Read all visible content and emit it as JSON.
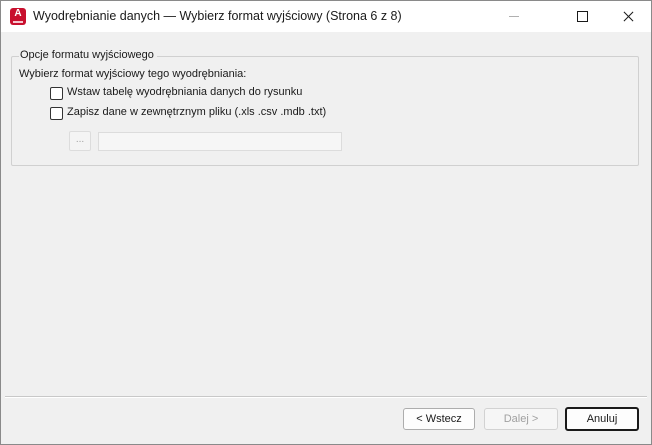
{
  "window": {
    "title": "Wyodrębnianie danych — Wybierz format wyjściowy (Strona 6 z 8)",
    "app_icon_letter": "A",
    "controls": [
      "minimize-icon",
      "maximize-icon",
      "close-icon"
    ]
  },
  "options_group": {
    "legend": "Opcje formatu wyjściowego",
    "prompt": "Wybierz format wyjściowy tego wyodrębniania:",
    "checkboxes": [
      {
        "label": "Wstaw tabelę wyodrębniania danych do rysunku",
        "checked": false
      },
      {
        "label": "Zapisz dane w zewnętrznym pliku (.xls .csv .mdb .txt)",
        "checked": false
      }
    ],
    "browse_label": "...",
    "file_path_value": ""
  },
  "buttons": {
    "back": "< Wstecz",
    "next": "Dalej >",
    "cancel": "Anuluj"
  },
  "colors": {
    "app_icon": "#c8102e",
    "dialog_bg": "#f0f0f0",
    "titlebar_bg": "#ffffff"
  }
}
